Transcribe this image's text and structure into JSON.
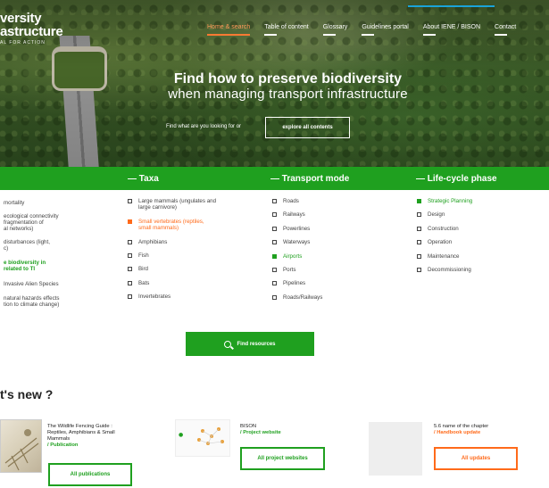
{
  "header": {
    "logo_line1": "versity",
    "logo_line2": "astructure",
    "logo_line3": "AL FOR ACTION"
  },
  "nav": [
    {
      "label": "Home & search",
      "active": true
    },
    {
      "label": "Table of content",
      "active": false
    },
    {
      "label": "Glossary",
      "active": false
    },
    {
      "label": "Guidelines portal",
      "active": false
    },
    {
      "label": "About IENE / BISON",
      "active": false
    },
    {
      "label": "Contact",
      "active": false
    }
  ],
  "hero": {
    "title": "Find how to preserve biodiversity",
    "subtitle": "when managing transport infrastructure",
    "find_prompt": "Find what are you looking for or",
    "explore_label": "explore all contents"
  },
  "categories": {
    "taxa_title": "— Taxa",
    "transport_title": "— Transport mode",
    "lifecycle_title": "— Life-cycle phase",
    "left_items": [
      {
        "label": "mortality",
        "state": "normal"
      },
      {
        "label": "ecological connectivity",
        "state": "normal"
      },
      {
        "label": "fragmentation of",
        "state": "normal"
      },
      {
        "label": "al networks)",
        "state": "normal"
      },
      {
        "label": "disturbances (light,",
        "state": "normal"
      },
      {
        "label": "c)",
        "state": "normal"
      },
      {
        "label": "e biodiversity in",
        "state": "selected"
      },
      {
        "label": "related to TI",
        "state": "selected"
      },
      {
        "label": "Invasive Alien Species",
        "state": "normal"
      },
      {
        "label": "natural hazards effects",
        "state": "normal"
      },
      {
        "label": "tion to climate change)",
        "state": "normal"
      }
    ],
    "taxa": [
      {
        "label": "Large mammals (ungulates and",
        "label2": "large carnivore)",
        "state": "normal"
      },
      {
        "label": "Small vertebrates (reptiles,",
        "label2": "small mammals)",
        "state": "highlight"
      },
      {
        "label": "Amphibians",
        "label2": "",
        "state": "normal"
      },
      {
        "label": "Fish",
        "label2": "",
        "state": "normal"
      },
      {
        "label": "Bird",
        "label2": "",
        "state": "normal"
      },
      {
        "label": "Bats",
        "label2": "",
        "state": "normal"
      },
      {
        "label": "Invertebrates",
        "label2": "",
        "state": "normal"
      }
    ],
    "transport": [
      {
        "label": "Roads",
        "state": "normal"
      },
      {
        "label": "Railways",
        "state": "normal"
      },
      {
        "label": "Powerlines",
        "state": "normal"
      },
      {
        "label": "Waterways",
        "state": "normal"
      },
      {
        "label": "Airports",
        "state": "selected"
      },
      {
        "label": "Ports",
        "state": "normal"
      },
      {
        "label": "Pipelines",
        "state": "normal"
      },
      {
        "label": "Roads/Railways",
        "state": "normal"
      }
    ],
    "lifecycle": [
      {
        "label": "Strategic Planning",
        "state": "selected"
      },
      {
        "label": "Design",
        "state": "normal"
      },
      {
        "label": "Construction",
        "state": "normal"
      },
      {
        "label": "Operation",
        "state": "normal"
      },
      {
        "label": "Maintenance",
        "state": "normal"
      },
      {
        "label": "Decommissioning",
        "state": "normal"
      }
    ]
  },
  "find_resources_label": "Find resources",
  "whats_new_title": "t's new ?",
  "news": [
    {
      "title": "The Wildlife Fencing Guide :",
      "title2": "Reptiles, Amphibians & Small",
      "title3": "Mammals",
      "tag": "/ Publication",
      "button": "All publications"
    },
    {
      "title": "BISON",
      "title2": "",
      "title3": "",
      "tag": "/ Project website",
      "button": "All project websites"
    },
    {
      "title": "5.6 name of the chapter",
      "title2": "",
      "title3": "",
      "tag": "/ Handbook update",
      "button": "All updates"
    }
  ],
  "colors": {
    "green": "#1fa01f",
    "orange": "#ff6a1a",
    "link_blue": "#1aa3d9"
  }
}
